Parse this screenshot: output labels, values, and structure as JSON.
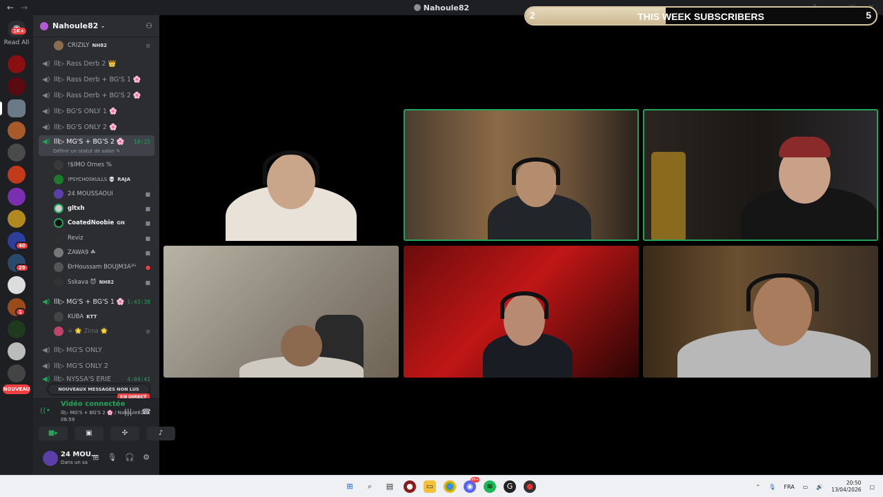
{
  "window": {
    "title": "Nahoule82",
    "back": "←",
    "forward": "→"
  },
  "rail": {
    "dm_badge": "1K+",
    "read_all": "Read All",
    "badges": {
      "s40": "40",
      "s29": "29",
      "s1": "1"
    },
    "nouveau": "NOUVEAU"
  },
  "server": {
    "name": "Nahoule82"
  },
  "channels": {
    "top_user": {
      "name": "CRIZILY",
      "tag": "NH82"
    },
    "rass_derb_2": "lll▷ Rass Derb 2 👑",
    "rass_derb_bgs_1": "lll▷ Rass Derb + BG'S 1 🌸",
    "rass_derb_bgs_2": "lll▷ Rass Derb + BG'S 2 🌸",
    "bgs_only_1": "lll▷ BG'S ONLY 1 🌸",
    "bgs_only_2": "lll▷ BG'S ONLY 2 🌸",
    "mgs_bgs_2": {
      "label": "lll▷ MG'S + BG'S 2 🌸",
      "time": "10:15",
      "sub": "Définir un statut de salon ✎"
    },
    "mgs_bgs_2_users": [
      {
        "name": "!$IMO Ornes %"
      },
      {
        "name": "!PSYCHOSKULLS 💀",
        "tag": "RAJA"
      },
      {
        "name": "24 MOUSSAOUI"
      },
      {
        "name": "gltxh"
      },
      {
        "name": "CoatedNoobie",
        "tag": "GN"
      },
      {
        "name": "Reviz"
      },
      {
        "name": "ZAWA9 ☘"
      },
      {
        "name": "ÐrHoussam BOUJM3A³ᴳ"
      },
      {
        "name": "Sskava 😈",
        "tag": "NH82"
      }
    ],
    "mgs_bgs_1": {
      "label": "lll▷ MG'S + BG'S 1 🌸",
      "time": "1:43:38"
    },
    "mgs_bgs_1_users": [
      {
        "name": "KUBA",
        "tag": "KTT"
      },
      {
        "name": "☠ 🌟 Ziina 🌟"
      }
    ],
    "mgs_only": "lll▷ MG'S ONLY",
    "mgs_only_2": "lll▷ MG'S ONLY 2",
    "nyssas": {
      "label": "lll▷ NYSSA'S ERIE",
      "time": "4:04:41"
    },
    "new_messages": "NOUVEAUX MESSAGES NON LUS",
    "live": "EN DIRECT"
  },
  "voice": {
    "status": "Vidéo connectée",
    "channel": "lll▷ MG'S + BG'S 2 🌸 / Nahoule82",
    "elapsed": "08:59"
  },
  "user_panel": {
    "name": "24 MOU…",
    "status": "Dans un sa"
  },
  "subscribers": {
    "label": "THIS WEEK SUBSCRIBERS",
    "current": "2",
    "goal": "5",
    "progress": 0.4
  },
  "taskbar": {
    "lang": "FRA",
    "time": "20:50",
    "date": "13/04/2026",
    "badge": "99+"
  },
  "colors": {
    "speaking": "#23a559",
    "accent": "#5865f2",
    "danger": "#f23f43"
  }
}
